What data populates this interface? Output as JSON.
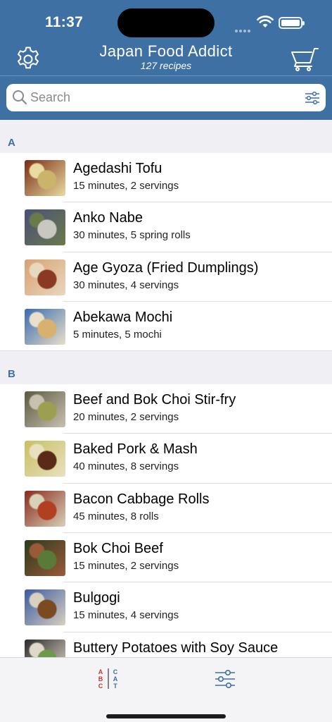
{
  "status_bar": {
    "time": "11:37"
  },
  "header": {
    "title": "Japan Food Addict",
    "subtitle": "127 recipes"
  },
  "search": {
    "placeholder": "Search"
  },
  "sections": [
    {
      "letter": "A",
      "recipes": [
        {
          "name": "Agedashi Tofu",
          "meta": "15 minutes, 2 servings",
          "colors": [
            "#7a2a14",
            "#c9b46a",
            "#e8dca0"
          ]
        },
        {
          "name": "Anko Nabe",
          "meta": "30 minutes, 5 spring rolls",
          "colors": [
            "#4a4f7a",
            "#c8c8c0",
            "#6a7a4a"
          ]
        },
        {
          "name": "Age Gyoza (Fried Dumplings)",
          "meta": "30 minutes, 4 servings",
          "colors": [
            "#d9a070",
            "#8a3a24",
            "#e8d8c0"
          ]
        },
        {
          "name": "Abekawa Mochi",
          "meta": "5 minutes, 5 mochi",
          "colors": [
            "#3a6ab0",
            "#d8b070",
            "#e8e0c8"
          ]
        }
      ]
    },
    {
      "letter": "B",
      "recipes": [
        {
          "name": "Beef and Bok Choi Stir-fry",
          "meta": "20 minutes, 2 servings",
          "colors": [
            "#5a5a40",
            "#9aa050",
            "#c8c0b0"
          ]
        },
        {
          "name": "Baked Pork & Mash",
          "meta": "40 minutes, 8 servings",
          "colors": [
            "#c8c060",
            "#5a2a18",
            "#e8e0c0"
          ]
        },
        {
          "name": "Bacon Cabbage Rolls",
          "meta": "45 minutes, 8 rolls",
          "colors": [
            "#8a2a1a",
            "#b04020",
            "#d8d0b8"
          ]
        },
        {
          "name": "Bok Choi Beef",
          "meta": "15 minutes, 2 servings",
          "colors": [
            "#2a3a1a",
            "#5a7a3a",
            "#9a5a3a"
          ]
        },
        {
          "name": "Bulgogi",
          "meta": "15 minutes, 4 servings",
          "colors": [
            "#3a5aa0",
            "#7a4a20",
            "#d8d0c0"
          ]
        },
        {
          "name": "Buttery Potatoes with Soy Sauce",
          "meta": "",
          "colors": [
            "#2a2a2a",
            "#6a9a4a",
            "#e0d8c8"
          ]
        }
      ]
    }
  ],
  "tabbar": {
    "abc_letters": [
      "A",
      "B",
      "C"
    ],
    "cat_letters": [
      "C",
      "A",
      "T"
    ],
    "abc_color": "#c0392b",
    "cat_color": "#3f70a4"
  },
  "colors": {
    "header_bg": "#3f70a4",
    "section_bg": "#efeff4",
    "accent": "#3f70a4"
  }
}
